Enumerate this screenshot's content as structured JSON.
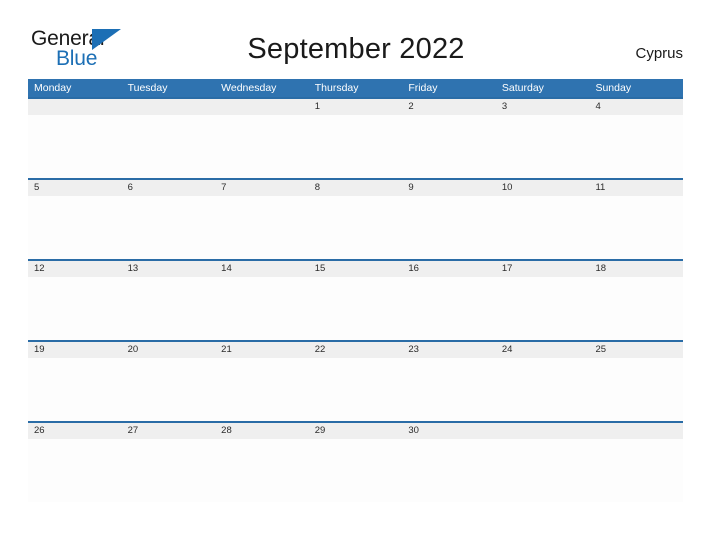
{
  "brand": {
    "line1": "General",
    "line2": "Blue",
    "flag_icon": "blue-triangle-flag",
    "primary_color": "#1c6fb5"
  },
  "header": {
    "title": "September 2022",
    "region": "Cyprus"
  },
  "theme": {
    "header_blue": "#2f73b0",
    "row_border_blue": "#2a6ca6",
    "day_band_gray": "#efefef",
    "body_white": "#fdfdfd",
    "text_dark": "#1a1a1a"
  },
  "calendar": {
    "month": "September",
    "year": "2022",
    "weekday_headers": [
      "Monday",
      "Tuesday",
      "Wednesday",
      "Thursday",
      "Friday",
      "Saturday",
      "Sunday"
    ],
    "weeks": [
      [
        "",
        "",
        "",
        "1",
        "2",
        "3",
        "4"
      ],
      [
        "5",
        "6",
        "7",
        "8",
        "9",
        "10",
        "11"
      ],
      [
        "12",
        "13",
        "14",
        "15",
        "16",
        "17",
        "18"
      ],
      [
        "19",
        "20",
        "21",
        "22",
        "23",
        "24",
        "25"
      ],
      [
        "26",
        "27",
        "28",
        "29",
        "30",
        "",
        ""
      ]
    ]
  }
}
